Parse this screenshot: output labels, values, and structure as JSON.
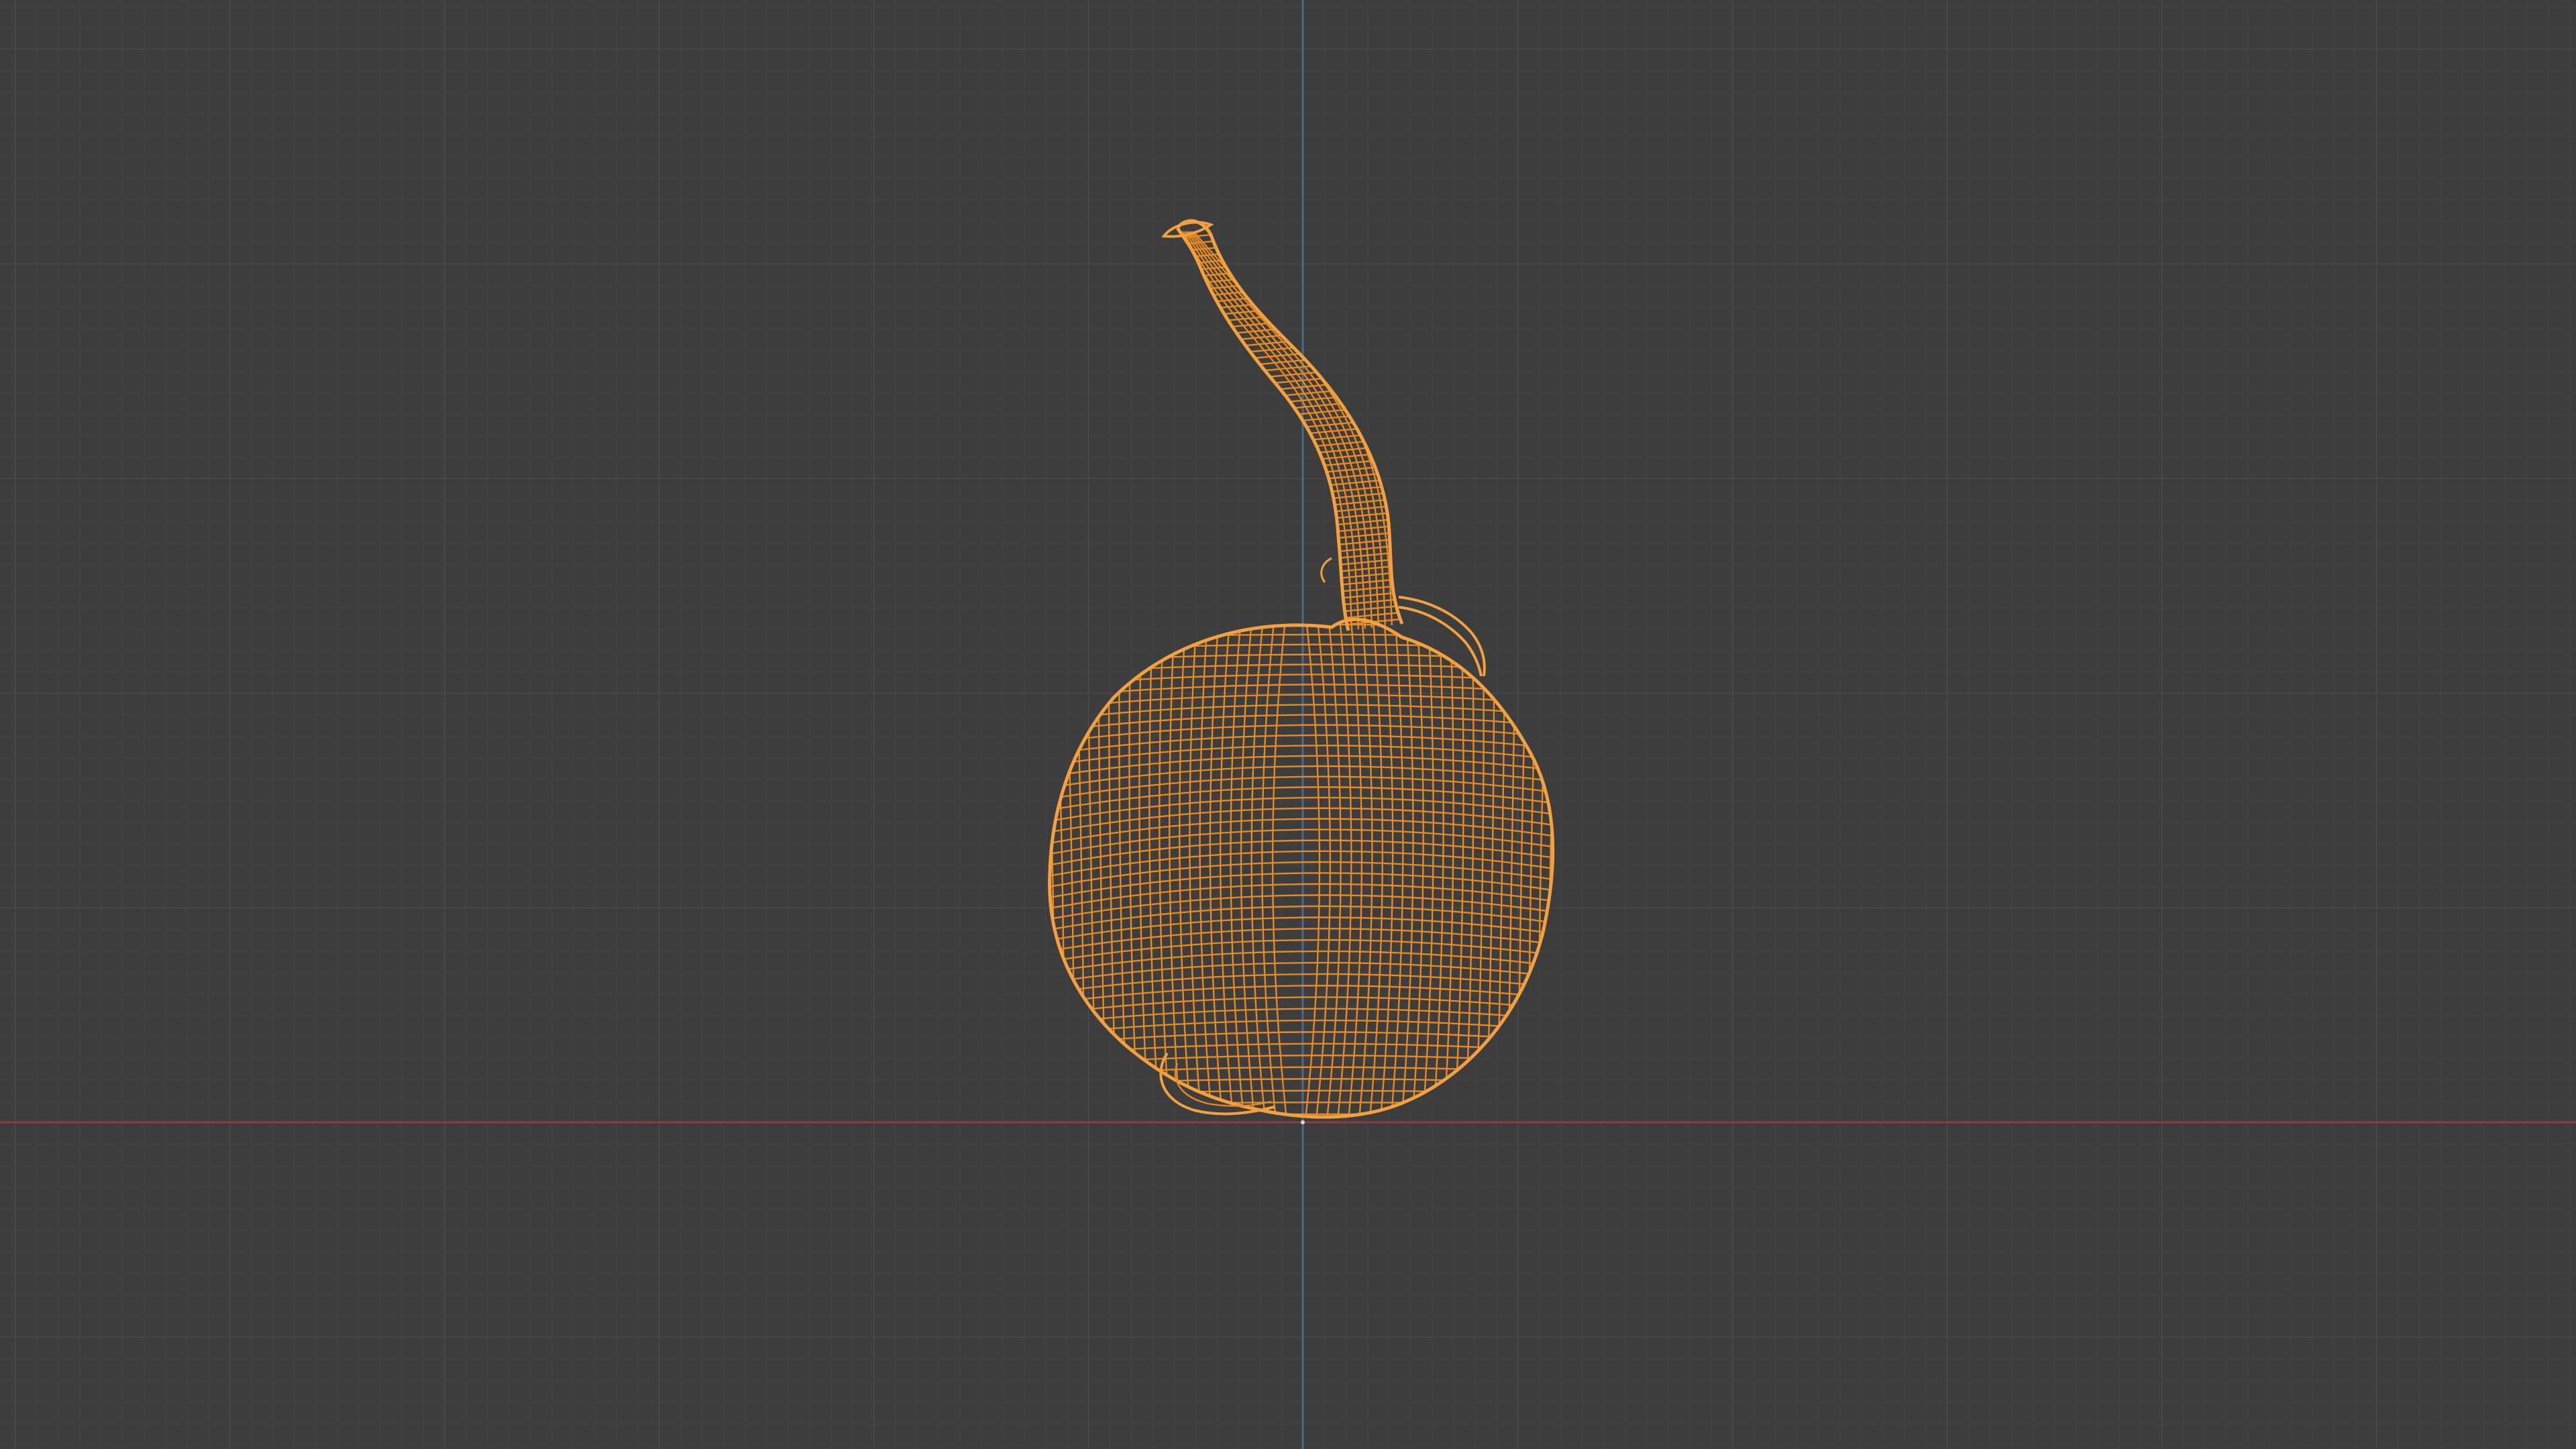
{
  "viewport": {
    "mode": "wireframe",
    "object": "gourd-mesh",
    "selected": true,
    "colors": {
      "background": "#3d3d3d",
      "grid_minor": "#474747",
      "grid_major": "#525252",
      "axis_x": "#8a3f47",
      "axis_z": "#4c6a8a",
      "wire_selected": "#e58a24",
      "wire_outline": "#f2a040"
    }
  }
}
